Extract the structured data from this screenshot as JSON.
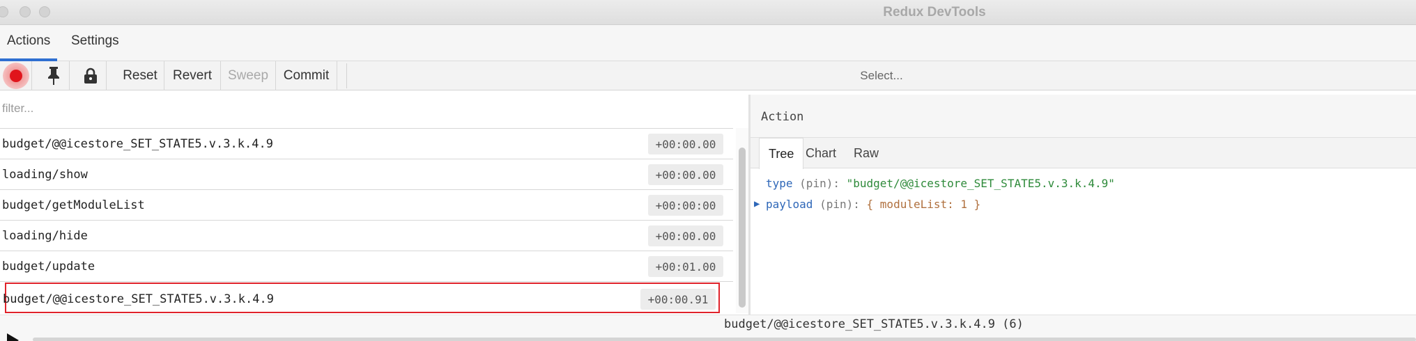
{
  "window": {
    "title": "Redux DevTools"
  },
  "tabs": [
    {
      "label": "Actions"
    },
    {
      "label": "Settings"
    }
  ],
  "toolbar": {
    "record_icon": "record-icon",
    "pin_icon": "pin-icon",
    "lock_icon": "lock-icon",
    "reset_label": "Reset",
    "revert_label": "Revert",
    "sweep_label": "Sweep",
    "commit_label": "Commit",
    "select_placeholder": "Select..."
  },
  "filter": {
    "placeholder": "filter...",
    "value": ""
  },
  "actions": [
    {
      "name": "budget/@@icestore_SET_STATE5.v.3.k.4.9",
      "time": "+00:00.00"
    },
    {
      "name": "loading/show",
      "time": "+00:00.00"
    },
    {
      "name": "budget/getModuleList",
      "time": "+00:00:00"
    },
    {
      "name": "loading/hide",
      "time": "+00:00.00"
    },
    {
      "name": "budget/update",
      "time": "+00:01.00"
    },
    {
      "name": "budget/@@icestore_SET_STATE5.v.3.k.4.9",
      "time": "+00:00.91",
      "selected": true
    }
  ],
  "right_panel": {
    "header": "Action",
    "subtabs": [
      {
        "label": "Tree"
      },
      {
        "label": "Chart"
      },
      {
        "label": "Raw"
      }
    ],
    "tree": {
      "type_key": "type",
      "type_pin": "(pin)",
      "colon": ":",
      "type_value": "\"budget/@@icestore_SET_STATE5.v.3.k.4.9\"",
      "payload_key": "payload",
      "payload_pin": "(pin)",
      "payload_value": "{ moduleList: 1 }"
    }
  },
  "footer": {
    "label": "budget/@@icestore_SET_STATE5.v.3.k.4.9 (6)"
  },
  "colors": {
    "accent": "#2f6fd1",
    "record": "#e0151c",
    "selection": "#e0232b"
  }
}
